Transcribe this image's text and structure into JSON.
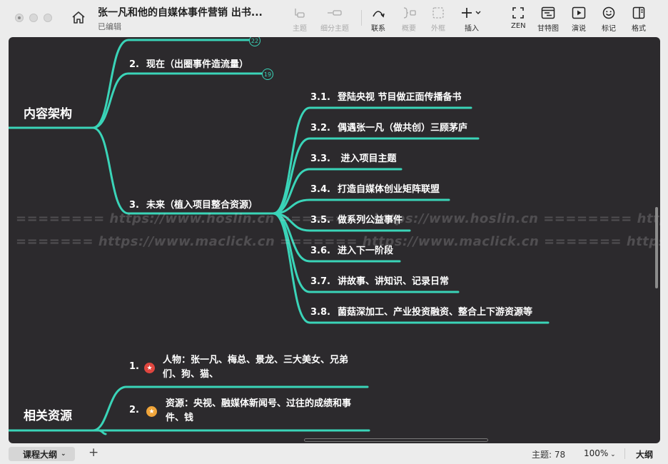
{
  "window": {
    "title": "张一凡和他的自媒体事件营销 出书...",
    "status": "已编辑"
  },
  "toolbar": {
    "topic": "主题",
    "subtopic": "细分主题",
    "relation": "联系",
    "summary": "概要",
    "boundary": "外框",
    "insert": "插入",
    "zen": "ZEN",
    "gantt": "甘特图",
    "present": "演说",
    "marker": "标记",
    "format": "格式"
  },
  "map": {
    "top_badge": "22",
    "root_content": "内容架构",
    "present": {
      "num": "2.",
      "text": "现在（出圈事件造流量）",
      "badge": "19"
    },
    "future": {
      "num": "3.",
      "text": "未来（植入项目整合资源）",
      "children": [
        {
          "num": "3.1.",
          "text": "登陆央视  节目做正面传播备书"
        },
        {
          "num": "3.2.",
          "text": "偶遇张一凡（做共创）三顾茅庐"
        },
        {
          "num": "3.3.",
          "text": " 进入项目主题"
        },
        {
          "num": "3.4.",
          "text": "打造自媒体创业矩阵联盟"
        },
        {
          "num": "3.5.",
          "text": "做系列公益事件"
        },
        {
          "num": "3.6.",
          "text": "进入下一阶段"
        },
        {
          "num": "3.7.",
          "text": "讲故事、讲知识、记录日常"
        },
        {
          "num": "3.8.",
          "text": "菌菇深加工、产业投资融资、整合上下游资源等"
        }
      ]
    },
    "root_resources": "相关资源",
    "resources": [
      {
        "num": "1.",
        "line1": "人物：张一凡、梅总、景龙、三大美女、兄弟",
        "line2": "们、狗、猫、",
        "icon_color": "#e0463f"
      },
      {
        "num": "2.",
        "line1": "资源：央视、融媒体新闻号、过往的成绩和事",
        "line2": "件、钱",
        "icon_color": "#f0a53a"
      }
    ],
    "line_color": "#3ad4b8",
    "canvas_color": "#2c2a2d"
  },
  "watermarks": {
    "line1": "======== https://www.hoslin.cn ======== https://www.hoslin.cn ======== https://www.hoslin.cn ========",
    "line2": "======= https://www.maclick.cn ======= https://www.maclick.cn ======= https://www.maclick.cn ======="
  },
  "statusbar": {
    "sheet": "课程大纲",
    "add": "+",
    "topic_count": "主题: 78",
    "zoom": "100%",
    "mode": "大纲"
  }
}
